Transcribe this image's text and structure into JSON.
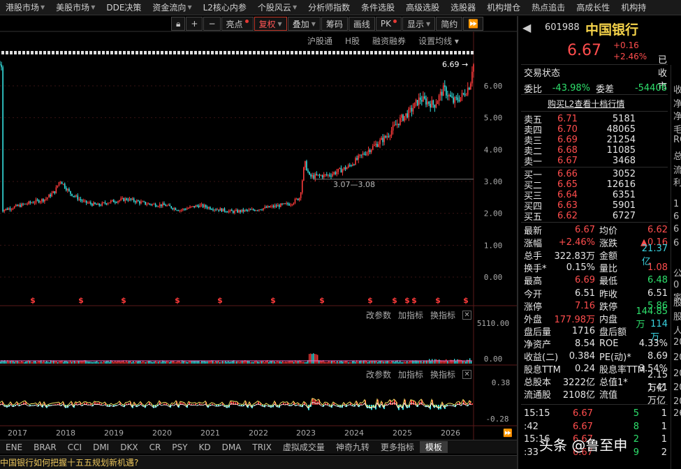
{
  "menu": [
    {
      "label": "港股市场",
      "dropdown": true
    },
    {
      "label": "美股市场",
      "dropdown": true
    },
    {
      "label": "DDE决策",
      "dropdown": false
    },
    {
      "label": "资金流向",
      "dropdown": true
    },
    {
      "label": "L2核心内参",
      "dropdown": false
    },
    {
      "label": "个股风云",
      "dropdown": true
    },
    {
      "label": "分析师指数",
      "dropdown": false
    },
    {
      "label": "条件选股",
      "dropdown": false
    },
    {
      "label": "高级选股",
      "dropdown": false
    },
    {
      "label": "选股器",
      "dropdown": false
    },
    {
      "label": "机构增仓",
      "dropdown": false
    },
    {
      "label": "热点追击",
      "dropdown": false
    },
    {
      "label": "高成长性",
      "dropdown": false
    },
    {
      "label": "机构持",
      "dropdown": false
    }
  ],
  "toolbar": {
    "lock_icon": "lock-icon",
    "plus": "+",
    "minus": "−",
    "highlight": "亮点",
    "restore": "复权",
    "overlay": "叠加",
    "chips": "筹码",
    "draw": "画线",
    "pk": "PK",
    "display": "显示",
    "simple": "简约",
    "more": "⏩"
  },
  "subbar": [
    "沪股通",
    "H股",
    "融资融券",
    "设置均线"
  ],
  "chart": {
    "price_tag": "6.69",
    "y_ticks": [
      "6.00",
      "5.00",
      "4.00",
      "3.00",
      "2.00",
      "1.00",
      "0.00"
    ],
    "range_label": "3.07—3.08",
    "vol_ticks": [
      "5110.00",
      "0.00"
    ],
    "ind_ticks": [
      "0.38",
      "-0.28"
    ],
    "years": [
      "2017",
      "2018",
      "2019",
      "2020",
      "2021",
      "2022",
      "2023",
      "2024",
      "2025",
      "2026"
    ],
    "dividend_marker": "$"
  },
  "panel_controls": {
    "param": "改参数",
    "add": "加指标",
    "switch": "换指标",
    "close": "✕"
  },
  "bottom_tabs": [
    "ENE",
    "BRAR",
    "CCI",
    "DMI",
    "DKX",
    "CR",
    "PSY",
    "KD",
    "DMA",
    "TRIX",
    "虚拟成交量",
    "神奇九转",
    "更多指标",
    "模板"
  ],
  "news": "中国银行如何把握十五五规划新机遇?",
  "stock": {
    "code": "601988",
    "name": "中国银行",
    "price": "6.67",
    "change": "+0.16",
    "change_pct": "+2.46%",
    "status_label": "交易状态",
    "status": "已收市",
    "wb_label": "委比",
    "wb": "-43.98%",
    "wc_label": "委差",
    "wc": "-54406",
    "l2_link": "购买L2查看十档行情"
  },
  "asks": [
    {
      "label": "卖五",
      "price": "6.71",
      "vol": "5181"
    },
    {
      "label": "卖四",
      "price": "6.70",
      "vol": "48065"
    },
    {
      "label": "卖三",
      "price": "6.69",
      "vol": "21254"
    },
    {
      "label": "卖二",
      "price": "6.68",
      "vol": "11085"
    },
    {
      "label": "卖一",
      "price": "6.67",
      "vol": "3468"
    }
  ],
  "bids": [
    {
      "label": "买一",
      "price": "6.66",
      "vol": "3052"
    },
    {
      "label": "买二",
      "price": "6.65",
      "vol": "12616"
    },
    {
      "label": "买三",
      "price": "6.64",
      "vol": "6351"
    },
    {
      "label": "买四",
      "price": "6.63",
      "vol": "5901"
    },
    {
      "label": "买五",
      "price": "6.62",
      "vol": "6727"
    }
  ],
  "stats": [
    {
      "l1": "最新",
      "v1": "6.67",
      "c1": "red",
      "l2": "均价",
      "v2": "6.62",
      "c2": "red"
    },
    {
      "l1": "涨幅",
      "v1": "+2.46%",
      "c1": "red",
      "l2": "涨跌",
      "v2": "▲0.16",
      "c2": "red"
    },
    {
      "l1": "总手",
      "v1": "322.83万",
      "c1": "white",
      "l2": "金额",
      "v2": "21.37亿",
      "c2": "cyan"
    },
    {
      "l1": "换手*",
      "v1": "0.15%",
      "c1": "white",
      "l2": "量比",
      "v2": "1.08",
      "c2": "red"
    },
    {
      "l1": "最高",
      "v1": "6.69",
      "c1": "red",
      "l2": "最低",
      "v2": "6.48",
      "c2": "green"
    },
    {
      "l1": "今开",
      "v1": "6.51",
      "c1": "white",
      "l2": "昨收",
      "v2": "6.51",
      "c2": "white"
    },
    {
      "l1": "涨停",
      "v1": "7.16",
      "c1": "red",
      "l2": "跌停",
      "v2": "5.86",
      "c2": "green"
    },
    {
      "l1": "外盘",
      "v1": "177.98万",
      "c1": "red",
      "l2": "内盘",
      "v2": "144.85万",
      "c2": "green"
    },
    {
      "l1": "盘后量",
      "v1": "1716",
      "c1": "white",
      "l2": "盘后额",
      "v2": "114万",
      "c2": "cyan"
    },
    {
      "l1": "净资产",
      "v1": "8.54",
      "c1": "white",
      "l2": "ROE",
      "v2": "4.33%",
      "c2": "white"
    },
    {
      "l1": "收益(二)",
      "v1": "0.384",
      "c1": "white",
      "l2": "PE(动)*",
      "v2": "8.69",
      "c2": "white"
    },
    {
      "l1": "股息TTM",
      "v1": "0.24",
      "c1": "white",
      "l2": "股息率TTM",
      "v2": "3.54%",
      "c2": "white"
    },
    {
      "l1": "总股本",
      "v1": "3222亿",
      "c1": "white",
      "l2": "总值1*",
      "v2": "2.15万亿",
      "c2": "white"
    },
    {
      "l1": "流通股",
      "v1": "2108亿",
      "c1": "white",
      "l2": "流值",
      "v2": "1.41万亿",
      "c2": "white"
    }
  ],
  "ticks": [
    {
      "time": "15:15",
      "price": "6.67",
      "vol": "5",
      "n": "1"
    },
    {
      "time": ":42",
      "price": "6.67",
      "vol": "8",
      "n": "1"
    },
    {
      "time": "15:16",
      "price": "6.67",
      "vol": "2",
      "n": "1"
    },
    {
      "time": ":33",
      "price": "6.67",
      "vol": "9",
      "n": "2"
    }
  ],
  "clipped_right": [
    "收",
    "净",
    "净",
    "毛",
    "RO",
    "总",
    "流",
    "利",
    "1",
    "6",
    "6",
    "6",
    "公",
    "0家",
    "股",
    "股",
    "人",
    "20",
    "20",
    "20",
    "20",
    "20",
    "26"
  ],
  "watermark": "头条 @鲁至申",
  "colors": {
    "up": "#ff4d4d",
    "down": "#2ee06c",
    "name": "#f5d34a",
    "link": "#e8c35a"
  },
  "chart_data": {
    "type": "candlestick",
    "title": "",
    "x_years": [
      "2017",
      "2018",
      "2019",
      "2020",
      "2021",
      "2022",
      "2023",
      "2024",
      "2025",
      "2026"
    ],
    "ylim": [
      0,
      6.69
    ],
    "close_path": [
      {
        "x": 2016.8,
        "y": 2.1
      },
      {
        "x": 2017.3,
        "y": 2.3
      },
      {
        "x": 2017.7,
        "y": 2.45
      },
      {
        "x": 2017.9,
        "y": 2.7
      },
      {
        "x": 2018.0,
        "y": 3.05
      },
      {
        "x": 2018.2,
        "y": 2.65
      },
      {
        "x": 2018.5,
        "y": 2.35
      },
      {
        "x": 2018.8,
        "y": 2.25
      },
      {
        "x": 2019.0,
        "y": 2.35
      },
      {
        "x": 2019.4,
        "y": 2.45
      },
      {
        "x": 2019.8,
        "y": 2.3
      },
      {
        "x": 2020.2,
        "y": 2.25
      },
      {
        "x": 2020.5,
        "y": 2.1
      },
      {
        "x": 2020.9,
        "y": 2.25
      },
      {
        "x": 2021.2,
        "y": 2.15
      },
      {
        "x": 2021.6,
        "y": 2.05
      },
      {
        "x": 2022.0,
        "y": 2.1
      },
      {
        "x": 2022.4,
        "y": 2.2
      },
      {
        "x": 2022.8,
        "y": 2.3
      },
      {
        "x": 2023.0,
        "y": 2.5
      },
      {
        "x": 2023.1,
        "y": 3.6
      },
      {
        "x": 2023.2,
        "y": 3.15
      },
      {
        "x": 2023.6,
        "y": 3.2
      },
      {
        "x": 2024.0,
        "y": 3.45
      },
      {
        "x": 2024.4,
        "y": 3.95
      },
      {
        "x": 2024.8,
        "y": 4.4
      },
      {
        "x": 2025.1,
        "y": 4.95
      },
      {
        "x": 2025.3,
        "y": 5.2
      },
      {
        "x": 2025.5,
        "y": 5.6
      },
      {
        "x": 2025.8,
        "y": 5.4
      },
      {
        "x": 2026.0,
        "y": 5.9
      },
      {
        "x": 2026.2,
        "y": 5.5
      },
      {
        "x": 2026.4,
        "y": 5.7
      },
      {
        "x": 2026.55,
        "y": 6.05
      },
      {
        "x": 2026.6,
        "y": 6.67
      }
    ]
  }
}
